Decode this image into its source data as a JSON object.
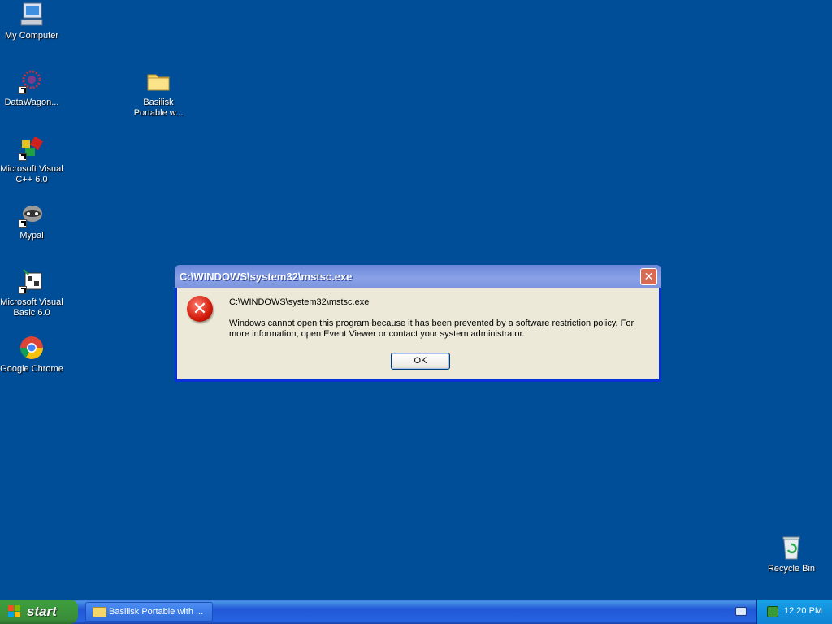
{
  "desktop": {
    "icons": [
      {
        "label": "My Computer",
        "icon": "my-computer-icon"
      },
      {
        "label": "DataWagon...",
        "icon": "datawagon-icon"
      },
      {
        "label": "Basilisk Portable w...",
        "icon": "folder-icon"
      },
      {
        "label": "Microsoft Visual C++ 6.0",
        "icon": "visual-cpp-icon"
      },
      {
        "label": "Mypal",
        "icon": "mypal-icon"
      },
      {
        "label": "Microsoft Visual Basic 6.0",
        "icon": "visual-basic-icon"
      },
      {
        "label": "Google Chrome",
        "icon": "chrome-icon"
      },
      {
        "label": "Recycle Bin",
        "icon": "recycle-bin-icon"
      }
    ]
  },
  "dialog": {
    "title": "C:\\WINDOWS\\system32\\mstsc.exe",
    "path_text": "C:\\WINDOWS\\system32\\mstsc.exe",
    "message": "Windows cannot open this program because it has been prevented by a software restriction policy. For more information, open Event Viewer or contact your system administrator.",
    "ok_label": "OK",
    "close_label": "✕",
    "icon": "error-icon"
  },
  "taskbar": {
    "start_label": "start",
    "task_label": "Basilisk Portable with ...",
    "clock": "12:20 PM"
  },
  "colors": {
    "desktop": "#004e98",
    "titlebar": "#7b95e0",
    "start": "#3c9a3c"
  }
}
